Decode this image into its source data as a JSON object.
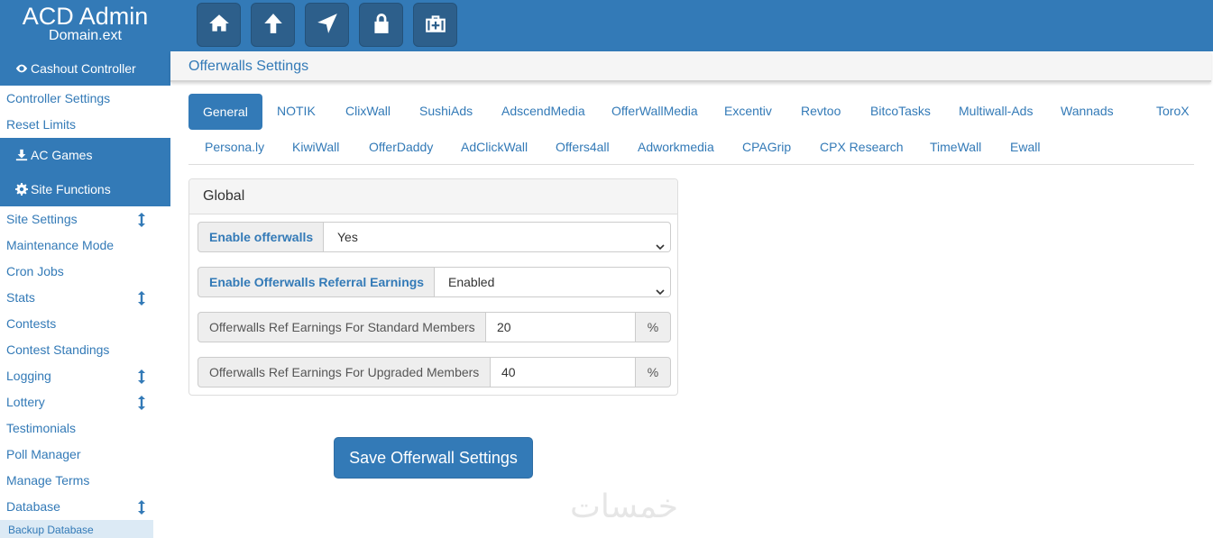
{
  "brand": {
    "title": "ACD Admin",
    "subtitle": "Domain.ext"
  },
  "topbar": {
    "buttons": [
      {
        "icon": "home-icon"
      },
      {
        "icon": "arrow-up-icon"
      },
      {
        "icon": "location-arrow-icon"
      },
      {
        "icon": "lock-icon"
      },
      {
        "icon": "medkit-icon"
      }
    ]
  },
  "sidebar": {
    "cashout_section": "Cashout Controller",
    "cashout_links": [
      "Controller Settings",
      "Reset Limits"
    ],
    "ac_games": "AC Games",
    "site_functions": "Site Functions",
    "site_links": [
      {
        "label": "Site Settings",
        "expand": true
      },
      {
        "label": "Maintenance Mode",
        "expand": false
      },
      {
        "label": "Cron Jobs",
        "expand": false
      },
      {
        "label": "Stats",
        "expand": true
      },
      {
        "label": "Contests",
        "expand": false
      },
      {
        "label": "Contest Standings",
        "expand": false
      },
      {
        "label": "Logging",
        "expand": true
      },
      {
        "label": "Lottery",
        "expand": true
      },
      {
        "label": "Testimonials",
        "expand": false
      },
      {
        "label": "Poll Manager",
        "expand": false
      },
      {
        "label": "Manage Terms",
        "expand": false
      },
      {
        "label": "Database",
        "expand": true
      }
    ],
    "partial_item": "Backup Database"
  },
  "main": {
    "title": "Offerwalls Settings",
    "tabs_row1": [
      "General",
      "NOTIK",
      "ClixWall",
      "SushiAds",
      "AdscendMedia",
      "OfferWallMedia",
      "Excentiv",
      "Revtoo",
      "BitcoTasks",
      "Multiwall-Ads",
      "Wannads",
      "ToroX"
    ],
    "tabs_row2": [
      "Persona.ly",
      "KiwiWall",
      "OfferDaddy",
      "AdClickWall",
      "Offers4all",
      "Adworkmedia",
      "CPAGrip",
      "CPX Research",
      "TimeWall",
      "Ewall"
    ],
    "active_tab": "General"
  },
  "panel": {
    "heading": "Global",
    "enable_offerwalls": {
      "label": "Enable offerwalls",
      "value": "Yes"
    },
    "enable_ref": {
      "label": "Enable Offerwalls Referral Earnings",
      "value": "Enabled"
    },
    "ref_standard": {
      "label": "Offerwalls Ref Earnings For Standard Members",
      "value": "20",
      "suffix": "%"
    },
    "ref_upgraded": {
      "label": "Offerwalls Ref Earnings For Upgraded Members",
      "value": "40",
      "suffix": "%"
    }
  },
  "save_button": "Save Offerwall Settings",
  "watermark": "خمسات",
  "colors": {
    "primary": "#337ab7",
    "dark_button": "#2d5f8b",
    "panel_bg": "#f5f5f5"
  }
}
